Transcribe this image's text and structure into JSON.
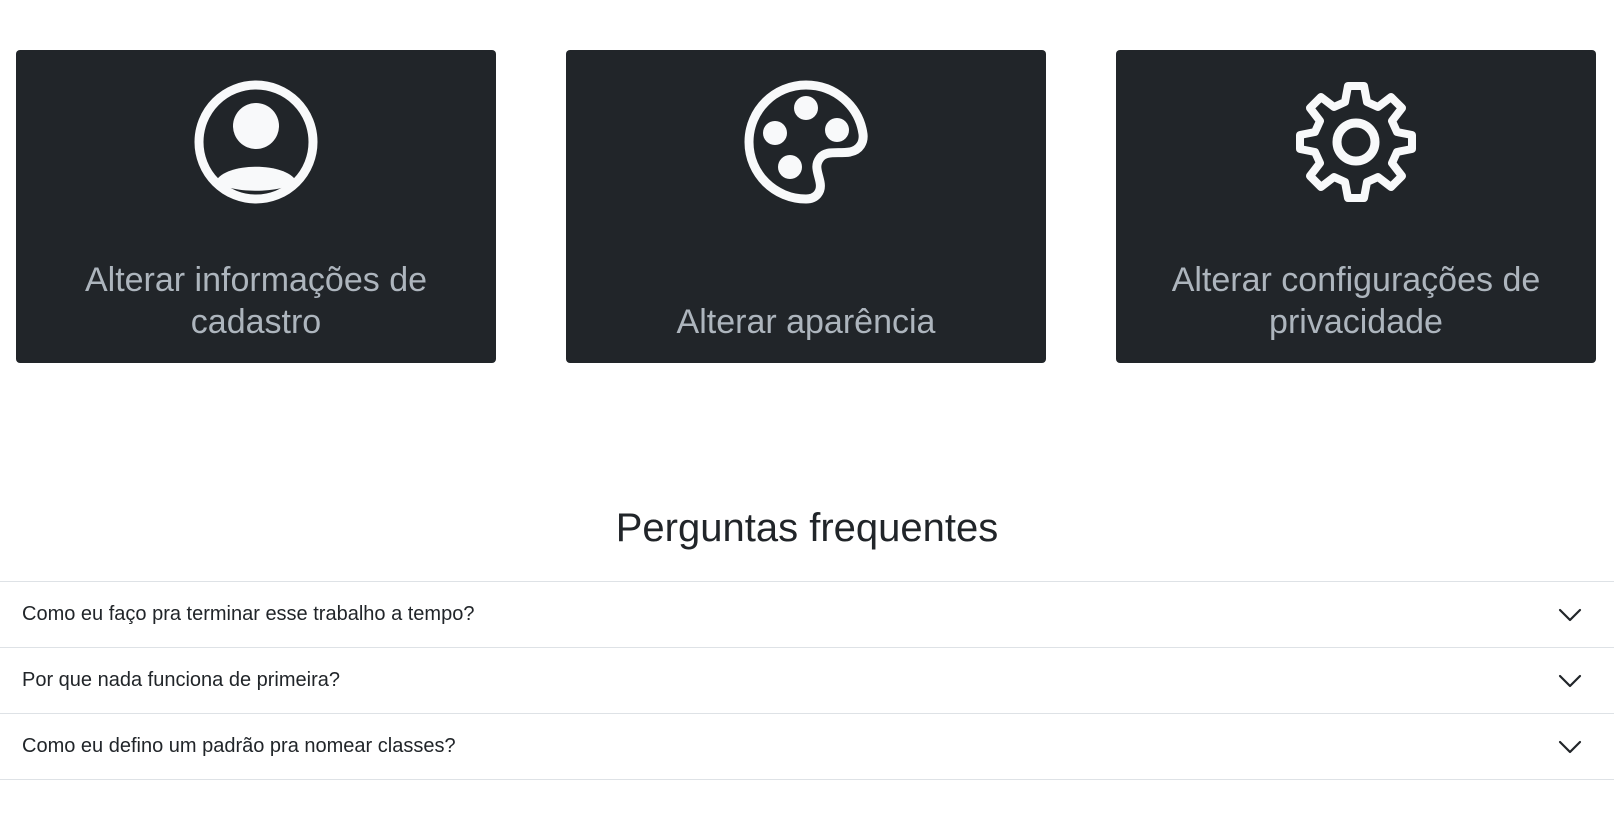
{
  "cards": [
    {
      "label": "Alterar informações de cadastro",
      "icon": "user-circle-icon"
    },
    {
      "label": "Alterar aparência",
      "icon": "palette-icon"
    },
    {
      "label": "Alterar configurações de privacidade",
      "icon": "gear-icon"
    }
  ],
  "faq": {
    "title": "Perguntas frequentes",
    "items": [
      {
        "question": "Como eu faço pra terminar esse trabalho a tempo?"
      },
      {
        "question": "Por que nada funciona de primeira?"
      },
      {
        "question": "Como eu defino um padrão pra nomear classes?"
      }
    ]
  },
  "colors": {
    "card_bg": "#212529",
    "card_text": "#adb5bd",
    "icon": "#f8f9fa",
    "text": "#212529",
    "divider": "#dee2e6"
  }
}
